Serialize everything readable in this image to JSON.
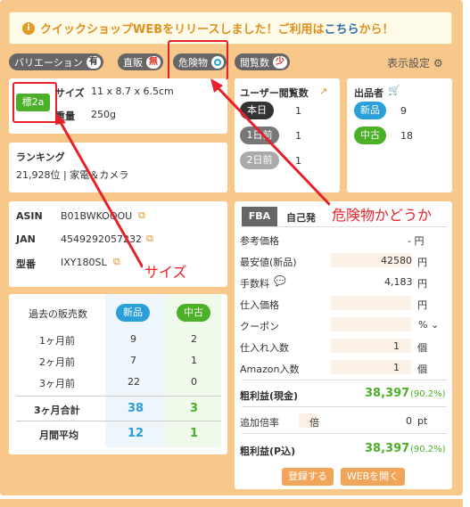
{
  "banner": {
    "text1": "クイックショップWEBをリリースしました！ご利用は",
    "link": "こちら",
    "text2": "から！"
  },
  "pills": [
    {
      "label": "バリエーション",
      "badge": "有"
    },
    {
      "label": "直販",
      "badge": "無"
    },
    {
      "label": "危険物",
      "badge": ""
    },
    {
      "label": "閲覧数",
      "badge": "少"
    }
  ],
  "display_settings": "表示設定",
  "size_card": {
    "size_tag": "標2a",
    "size_label": "サイズ",
    "size_value": "11 x 8.7 x 6.5cm",
    "weight_label": "重量",
    "weight_value": "250g"
  },
  "ranking": {
    "title": "ランキング",
    "value": "21,928位 | 家電＆カメラ"
  },
  "views": {
    "title": "ユーザー閲覧数",
    "rows": [
      {
        "label": "本日",
        "value": "1"
      },
      {
        "label": "1日前",
        "value": "1"
      },
      {
        "label": "2日前",
        "value": "1"
      }
    ]
  },
  "sellers": {
    "title": "出品者",
    "rows": [
      {
        "label": "新品",
        "value": "9"
      },
      {
        "label": "中古",
        "value": "18"
      }
    ]
  },
  "ids": {
    "asin_label": "ASIN",
    "asin": "B01BWKOQOU",
    "jan_label": "JAN",
    "jan": "4549292057232",
    "model_label": "型番",
    "model": "IXY180SL"
  },
  "annotations": {
    "size": "サイズ",
    "danger": "危険物かどうか"
  },
  "sales": {
    "header": "過去の販売数",
    "col_new": "新品",
    "col_used": "中古",
    "rows": [
      {
        "label": "1ヶ月前",
        "new": "9",
        "used": "2"
      },
      {
        "label": "2ヶ月前",
        "new": "7",
        "used": "1"
      },
      {
        "label": "3ヶ月前",
        "new": "22",
        "used": "0"
      }
    ],
    "total_label": "3ヶ月合計",
    "total_new": "38",
    "total_used": "3",
    "avg_label": "月間平均",
    "avg_new": "12",
    "avg_used": "1"
  },
  "calc": {
    "tab_fba": "FBA",
    "tab_self": "自己発",
    "ref_price_label": "参考価格",
    "ref_price": "- 円",
    "lowest_label": "最安値(新品)",
    "lowest": "42580",
    "yen": "円",
    "fee_label": "手数料",
    "fee": "4,183",
    "purchase_label": "仕入価格",
    "coupon_label": "クーポン",
    "percent": "%",
    "qty_label": "仕入れ入数",
    "qty": "1",
    "unit": "個",
    "amazon_qty_label": "Amazon入数",
    "amazon_qty": "1",
    "profit_cash_label": "粗利益(現金)",
    "profit_cash": "38,397",
    "profit_cash_pct": "(90.2%)",
    "rate_label": "追加倍率",
    "rate_unit": "倍",
    "pt_value": "0",
    "pt": "pt",
    "profit_p_label": "粗利益(P込)",
    "profit_p": "38,397",
    "profit_p_pct": "(90.2%)",
    "register_btn": "登録する",
    "web_btn": "WEBを開く"
  }
}
